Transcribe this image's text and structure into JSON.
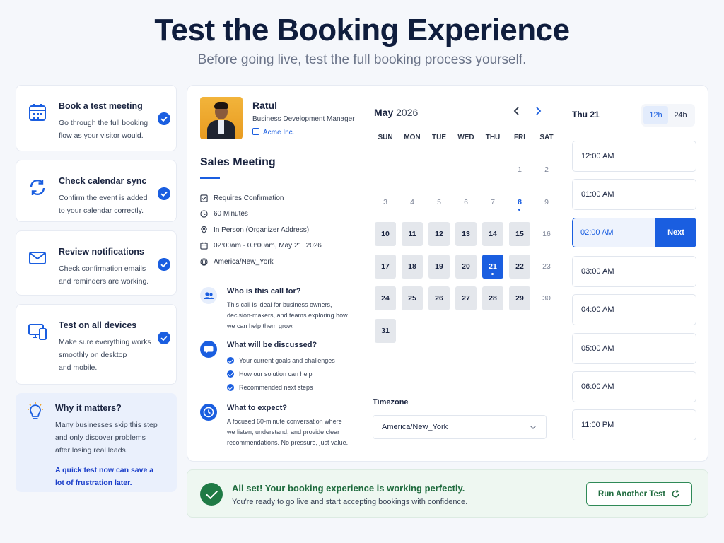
{
  "hero": {
    "title": "Test the Booking Experience",
    "subtitle": "Before going live, test the full booking process yourself."
  },
  "steps": [
    {
      "title": "Book a test meeting",
      "line1": "Go through the full booking",
      "line2": "flow as your visitor would.",
      "line3": "",
      "icon": "calendar-icon"
    },
    {
      "title": "Check calendar sync",
      "line1": "Confirm the event is added",
      "line2": "to your calendar correctly.",
      "line3": "",
      "icon": "sync-icon"
    },
    {
      "title": "Review notifications",
      "line1": "Check confirmation emails",
      "line2": "and reminders are working.",
      "line3": "",
      "icon": "mail-icon"
    },
    {
      "title": "Test on all devices",
      "line1": "Make sure everything works",
      "line2": "smoothly on desktop",
      "line3": "and mobile.",
      "icon": "devices-icon"
    }
  ],
  "why": {
    "title": "Why it matters?",
    "line1": "Many businesses skip this step",
    "line2": "and only discover problems",
    "line3": "after losing real leads.",
    "em1": "A quick test now can save a",
    "em2": "lot of frustration later."
  },
  "host": {
    "name": "Ratul",
    "role": "Business Development Manager",
    "company": "Acme Inc."
  },
  "meeting": {
    "title": "Sales Meeting",
    "details": [
      {
        "text": "Requires Confirmation",
        "icon": "checkbox-icon"
      },
      {
        "text": "60 Minutes",
        "icon": "clock-icon"
      },
      {
        "text": "In Person (Organizer Address)",
        "icon": "location-icon"
      },
      {
        "text": "02:00am - 03:00am, May 21, 2026",
        "icon": "calendar-icon"
      },
      {
        "text": "America/New_York",
        "icon": "globe-icon"
      }
    ],
    "who": {
      "title": "Who is this call for?",
      "line1": "This call is ideal for business owners,",
      "line2": "decision-makers, and teams exploring how",
      "line3": "we can help them grow."
    },
    "discussed": {
      "title": "What will be discussed?",
      "items": [
        "Your current goals and challenges",
        "How our solution can help",
        "Recommended next steps"
      ]
    },
    "expect": {
      "title": "What to expect?",
      "line1": "A focused 60-minute conversation where",
      "line2": "we listen, understand, and provide clear",
      "line3": "recommendations. No pressure, just value."
    }
  },
  "calendar": {
    "month": "May",
    "year": "2026",
    "weekdays": [
      "SUN",
      "MON",
      "TUE",
      "WED",
      "THU",
      "FRI",
      "SAT"
    ],
    "first_weekday_index": 5,
    "days_in_month": 31,
    "today": 8,
    "selected": 21,
    "available": [
      10,
      11,
      12,
      13,
      14,
      15,
      17,
      18,
      19,
      20,
      21,
      22,
      24,
      25,
      26,
      27,
      28,
      29,
      31
    ],
    "timezone_label": "Timezone",
    "timezone": "America/New_York"
  },
  "times": {
    "date_label": "Thu 21",
    "format_12": "12h",
    "format_24": "24h",
    "active_format": "12h",
    "slots": [
      "12:00 AM",
      "01:00 AM",
      "02:00 AM",
      "03:00 AM",
      "04:00 AM",
      "05:00 AM",
      "06:00 AM",
      "11:00 PM"
    ],
    "selected_slot": "02:00 AM",
    "next_label": "Next"
  },
  "banner": {
    "title": "All set! Your booking experience is working perfectly.",
    "text": "You're ready to go live and start accepting bookings with confidence.",
    "button": "Run Another Test"
  },
  "colors": {
    "accent": "#1a5ee0",
    "success": "#1f7a45",
    "title": "#0f1d3d"
  }
}
